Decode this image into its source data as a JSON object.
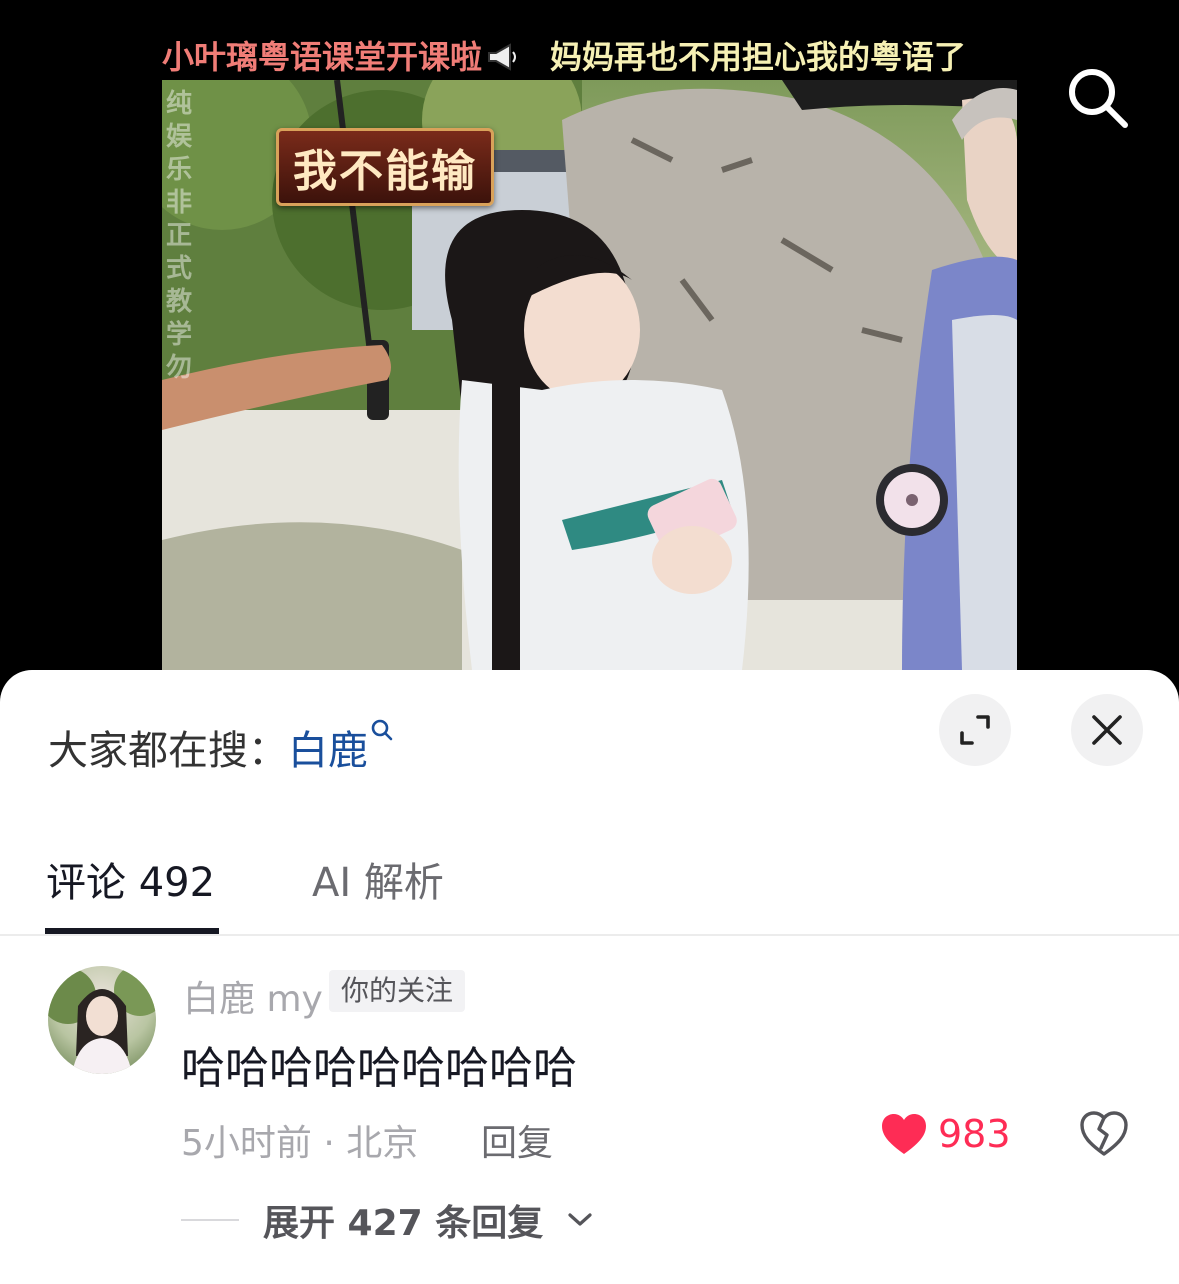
{
  "video": {
    "caption_left": "小叶璃粤语课堂开课啦",
    "caption_right": "妈妈再也不用担心我的粤语了",
    "title_card": "我不能输",
    "watermark": "纯 娱乐 非正式教学 勿"
  },
  "search_bar": {
    "prefix": "大家都在搜：",
    "term": "白鹿"
  },
  "tabs": [
    {
      "label": "评论 492",
      "active": true
    },
    {
      "label": "AI 解析",
      "active": false
    }
  ],
  "comment": {
    "username": "白鹿 my",
    "badge": "你的关注",
    "text": "哈哈哈哈哈哈哈哈哈",
    "meta": "5小时前 · 北京",
    "reply_label": "回复",
    "likes": "983",
    "expand_label": "展开 427 条回复"
  },
  "colors": {
    "accent_like": "#fe2c55",
    "search_term": "#1a4f9c",
    "caption_left": "#f07d77",
    "caption_right": "#f6f0b4"
  }
}
